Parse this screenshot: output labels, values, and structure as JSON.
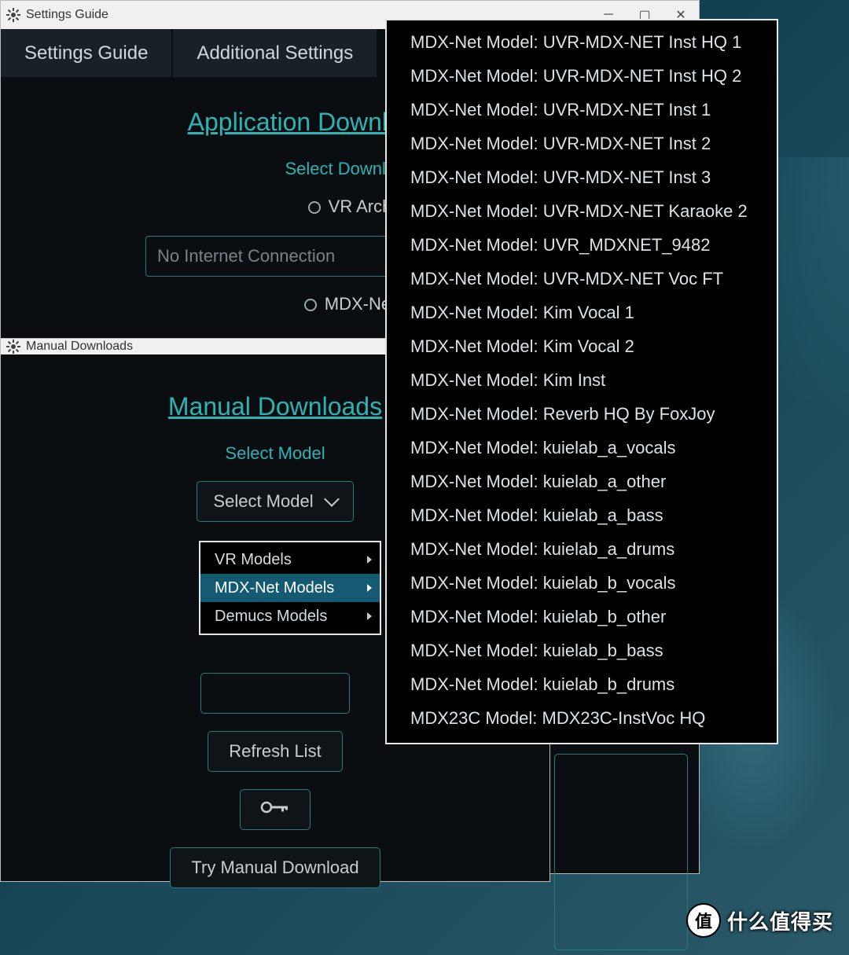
{
  "settings_window": {
    "title": "Settings Guide",
    "tabs": [
      "Settings Guide",
      "Additional Settings"
    ],
    "heading": "Application Download Center",
    "select_download_label": "Select Download",
    "radio_vr": "VR Arch",
    "radio_mdx": "MDX-Net",
    "status_text": "No Internet Connection"
  },
  "manual_window": {
    "title": "Manual Downloads",
    "heading": "Manual Downloads",
    "select_model_label": "Select Model",
    "dropdown_label": "Select Model",
    "refresh_button": "Refresh List",
    "try_manual_button": "Try Manual Download"
  },
  "category_menu": {
    "items": [
      "VR Models",
      "MDX-Net Models",
      "Demucs Models"
    ],
    "selected": "MDX-Net Models"
  },
  "model_submenu": [
    "MDX-Net Model: UVR-MDX-NET Inst HQ 1",
    "MDX-Net Model: UVR-MDX-NET Inst HQ 2",
    "MDX-Net Model: UVR-MDX-NET Inst 1",
    "MDX-Net Model: UVR-MDX-NET Inst 2",
    "MDX-Net Model: UVR-MDX-NET Inst 3",
    "MDX-Net Model: UVR-MDX-NET Karaoke 2",
    "MDX-Net Model: UVR_MDXNET_9482",
    "MDX-Net Model: UVR-MDX-NET Voc FT",
    "MDX-Net Model: Kim Vocal 1",
    "MDX-Net Model: Kim Vocal 2",
    "MDX-Net Model: Kim Inst",
    "MDX-Net Model: Reverb HQ By FoxJoy",
    "MDX-Net Model: kuielab_a_vocals",
    "MDX-Net Model: kuielab_a_other",
    "MDX-Net Model: kuielab_a_bass",
    "MDX-Net Model: kuielab_a_drums",
    "MDX-Net Model: kuielab_b_vocals",
    "MDX-Net Model: kuielab_b_other",
    "MDX-Net Model: kuielab_b_bass",
    "MDX-Net Model: kuielab_b_drums",
    "MDX23C Model: MDX23C-InstVoc HQ"
  ],
  "watermark": {
    "circle": "值",
    "text": "什么值得买"
  }
}
